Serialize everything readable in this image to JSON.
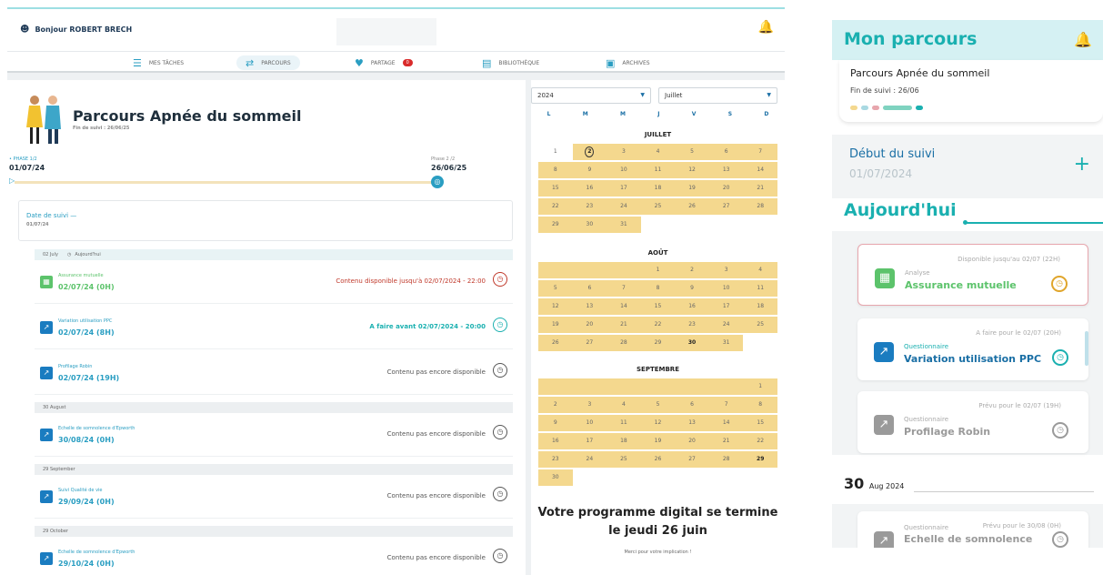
{
  "desktop": {
    "greeting": "Bonjour ROBERT BRECH",
    "nav": [
      {
        "label": "MES TÂCHES",
        "icon": "list-icon"
      },
      {
        "label": "PARCOURS",
        "icon": "route-icon",
        "active": true
      },
      {
        "label": "PARTAGE",
        "icon": "share-icon",
        "badge": "0"
      },
      {
        "label": "BIBLIOTHÈQUE",
        "icon": "book-icon"
      },
      {
        "label": "ARCHIVES",
        "icon": "archive-icon"
      }
    ],
    "title": "Parcours Apnée du sommeil",
    "end_label": "Fin de suivi : 26/06/25",
    "phase1_label": "• PHASE 1/2",
    "phase1_date": "01/07/24",
    "phase2_label": "Phase 2 /2",
    "phase2_date": "26/06/25",
    "follow_label": "Date de suivi  —",
    "follow_date": "01/07/24",
    "sections": [
      {
        "header": "02 July",
        "extra": "Aujourd'hui"
      },
      {
        "header": "30 August"
      },
      {
        "header": "29 September"
      },
      {
        "header": "29 October"
      }
    ],
    "tasks": [
      {
        "label": "Assurance mutuelle",
        "date": "02/07/24 (0H)",
        "status": "Contenu disponible jusqu'à 02/07/2024 - 22:00",
        "color": "#5cc36b",
        "status_color": "#c0392b",
        "icon": "calendar-icon"
      },
      {
        "label": "Variation utilisation PPC",
        "date": "02/07/24 (8H)",
        "status": "A faire avant 02/07/2024 - 20:00",
        "color": "#1a7cc0",
        "status_color": "#1ab0b0",
        "icon": "chart-icon"
      },
      {
        "label": "Profilage Robin",
        "date": "02/07/24 (19H)",
        "status": "Contenu pas encore disponible",
        "color": "#1a7cc0",
        "status_color": "#555",
        "icon": "chart-icon"
      },
      {
        "label": "Echelle de somnolence d'Epworth",
        "date": "30/08/24 (0H)",
        "status": "Contenu pas encore disponible",
        "color": "#1a7cc0",
        "status_color": "#555",
        "icon": "chart-icon"
      },
      {
        "label": "Suivi Qualité de vie",
        "date": "29/09/24 (0H)",
        "status": "Contenu pas encore disponible",
        "color": "#1a7cc0",
        "status_color": "#555",
        "icon": "chart-icon"
      },
      {
        "label": "Echelle de somnolence d'Epworth",
        "date": "29/10/24 (0H)",
        "status": "Contenu pas encore disponible",
        "color": "#1a7cc0",
        "status_color": "#555",
        "icon": "chart-icon"
      }
    ],
    "year": "2024",
    "month": "Juillet",
    "weekdays": [
      "L",
      "M",
      "M",
      "J",
      "V",
      "S",
      "D"
    ],
    "months": [
      {
        "name": "JUILLET",
        "lead_blank": 0,
        "days": 31,
        "white": [
          1
        ],
        "circled": 2,
        "bold": [
          2
        ]
      },
      {
        "name": "AOÛT",
        "lead_blank": 3,
        "days": 31,
        "white": [],
        "circled": 0,
        "bold": [
          30
        ]
      },
      {
        "name": "SEPTEMBRE",
        "lead_blank": 6,
        "days": 30,
        "white": [],
        "circled": 0,
        "bold": [
          29
        ]
      }
    ],
    "end_text": "Votre programme digital se termine le jeudi 26 juin",
    "thanks": "Merci pour votre implication !"
  },
  "mobile": {
    "title": "Mon parcours",
    "card_title": "Parcours Apnée du sommeil",
    "card_end": "Fin de suivi : 26/06",
    "debut_label": "Début du suivi",
    "debut_date": "01/07/2024",
    "today": "Aujourd'hui",
    "tasks": [
      {
        "category": "Analyse",
        "name": "Assurance mutuelle",
        "avail": "Disponible jusqu'au 02/07 (22H)",
        "color": "#5cc36b",
        "name_color": "#5cc36b",
        "clock_color": "#e0a52b",
        "bar": "#e7a6ad",
        "icon": "calendar-icon"
      },
      {
        "category": "Questionnaire",
        "name": "Variation utilisation PPC",
        "avail": "A faire pour le 02/07 (20H)",
        "color": "#1a7cc0",
        "name_color": "#1a6fa5",
        "clock_color": "#1ab0b0",
        "bar": "#bfe0ea",
        "icon": "chart-icon"
      },
      {
        "category": "Questionnaire",
        "name": "Profilage Robin",
        "avail": "Prévu pour le 02/07 (19H)",
        "color": "#9a9a9a",
        "name_color": "#9a9a9a",
        "clock_color": "#9a9a9a",
        "bar": "#e0e0e0",
        "icon": "chart-icon"
      }
    ],
    "date_day": "30",
    "date_rest": "Aug 2024",
    "next_task": {
      "category": "Questionnaire",
      "name": "Echelle de somnolence",
      "avail": "Prévu pour le 30/08 (0H)"
    }
  }
}
